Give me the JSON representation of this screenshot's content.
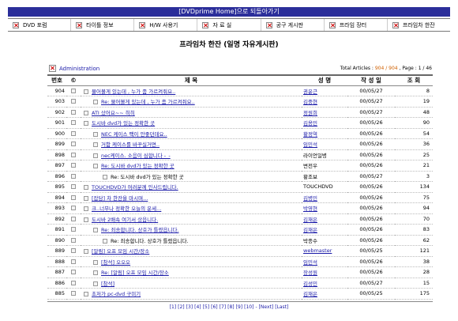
{
  "top_banner": "[DVDprime Home]으로 되돌아가기",
  "nav": [
    {
      "label": "DVD 포럼"
    },
    {
      "label": "타이틀 정보"
    },
    {
      "label": "H/W 사용기"
    },
    {
      "label": "자 료 실"
    },
    {
      "label": "공구 게시판"
    },
    {
      "label": "프라임 장터"
    },
    {
      "label": "프라임차 한잔"
    }
  ],
  "board_title": "프라임차 한잔 (일명 자유게시판)",
  "admin_label": "Administration",
  "stats": {
    "prefix": "Total Articles : ",
    "total": "904 / 904",
    "mid": " , Page : ",
    "page": "1 / 46"
  },
  "columns": {
    "num": "번호",
    "icon": "©",
    "subject": "제 목",
    "name": "성 명",
    "date": "작 성 일",
    "views": "조 회"
  },
  "rows": [
    {
      "num": "904",
      "subject": "물어볼게 있는데 , 누가 좀 가르켜줘요..",
      "indent": 0,
      "name": "권윤근",
      "date": "00/05/27",
      "views": "8"
    },
    {
      "num": "903",
      "subject": "Re: 물어볼게 있는데 , 누가 좀 가르켜줘요..",
      "indent": 1,
      "name": "김중현",
      "date": "00/05/27",
      "views": "19"
    },
    {
      "num": "902",
      "subject": "ATI 샀어요~~ 히히",
      "indent": 0,
      "name": "정원희",
      "date": "00/05/27",
      "views": "48"
    },
    {
      "num": "901",
      "subject": "도시바 dvd가 있는 정확한 곳",
      "indent": 0,
      "name": "김용민",
      "date": "00/05/26",
      "views": "90"
    },
    {
      "num": "900",
      "subject": "NEC 케이스 팩이 안좋던데요..",
      "indent": 1,
      "name": "황정역",
      "date": "00/05/26",
      "views": "54"
    },
    {
      "num": "899",
      "subject": "거함 케이스를 바꾸실거면..",
      "indent": 1,
      "name": "임민석",
      "date": "00/05/26",
      "views": "36"
    },
    {
      "num": "898",
      "subject": "nec케이스. 소음이 심합니다 -_-",
      "indent": 1,
      "name": "라이언일병",
      "date": "00/05/26",
      "views": "25"
    },
    {
      "num": "897",
      "subject": "Re: 도시바 dvd가 있는 정확한 곳",
      "indent": 1,
      "name": "변전우",
      "date": "00/05/26",
      "views": "21"
    },
    {
      "num": "896",
      "subject": "Re: 도시바 dvd가 있는 정확한 곳",
      "indent": 2,
      "name": "황조보",
      "date": "00/05/27",
      "views": "3"
    },
    {
      "num": "895",
      "subject": "TOUCHDVD가 여러분께 인사드립니다.",
      "indent": 0,
      "name": "TOUCHDVD",
      "date": "00/05/26",
      "views": "134"
    },
    {
      "num": "894",
      "subject": "[잡담] 차 한잔을 마시며...",
      "indent": 0,
      "name": "김병민",
      "date": "00/05/26",
      "views": "75"
    },
    {
      "num": "893",
      "subject": "크..너무나 정확한 오늘의 운세...",
      "indent": 0,
      "name": "박영현",
      "date": "00/05/26",
      "views": "94"
    },
    {
      "num": "892",
      "subject": "도시바 2배속 여기서 샀읍니다.",
      "indent": 0,
      "name": "김재은",
      "date": "00/05/26",
      "views": "70"
    },
    {
      "num": "891",
      "subject": "Re: 죄송합니다. 상호가 틀렸읍니다.",
      "indent": 1,
      "name": "김재은",
      "date": "00/05/26",
      "views": "83"
    },
    {
      "num": "890",
      "subject": "Re: 죄송합니다. 상호가 틀렸읍니다.",
      "indent": 2,
      "name": "박종수",
      "date": "00/05/26",
      "views": "62"
    },
    {
      "num": "889",
      "subject": "[알림] 오프 모임 시간/장소",
      "indent": 0,
      "name": "webmaster",
      "date": "00/05/25",
      "views": "121"
    },
    {
      "num": "888",
      "subject": "[참석] 오오오",
      "indent": 1,
      "name": "임민석",
      "date": "00/05/26",
      "views": "38"
    },
    {
      "num": "887",
      "subject": "Re: [알림] 오프 모임 시간/장소",
      "indent": 1,
      "name": "장성원",
      "date": "00/05/26",
      "views": "28"
    },
    {
      "num": "886",
      "subject": "[참석]",
      "indent": 1,
      "name": "김성민",
      "date": "00/05/27",
      "views": "15"
    },
    {
      "num": "885",
      "subject": "초저가 pc-dvd 구미기",
      "indent": 0,
      "name": "김재은",
      "date": "00/05/25",
      "views": "175"
    }
  ],
  "pager": [
    "[1]",
    "[2]",
    "[3]",
    "[4]",
    "[5]",
    "[6]",
    "[7]",
    "[8]",
    "[9]",
    "[10]",
    "- [Next]",
    "[Last]"
  ]
}
